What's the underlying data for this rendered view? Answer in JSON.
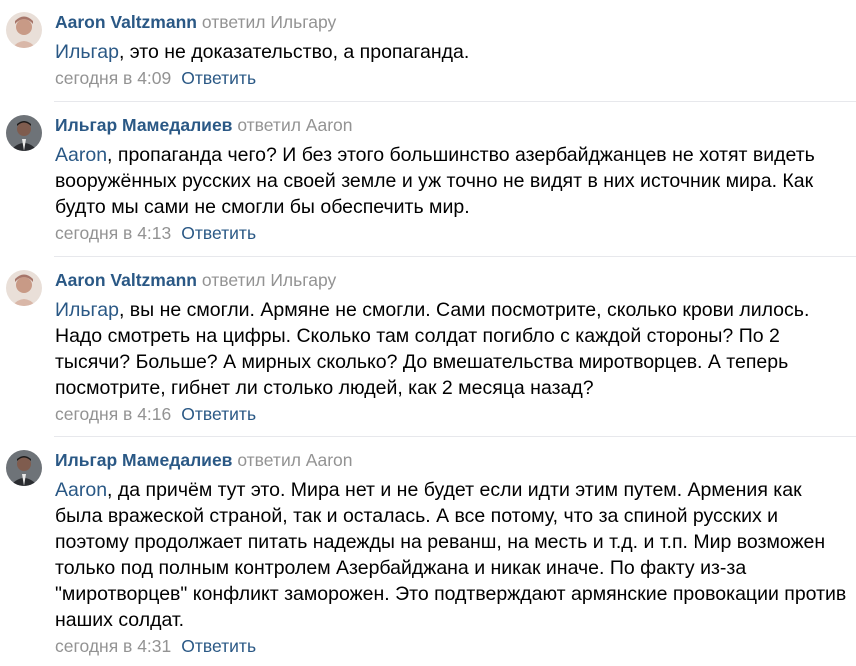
{
  "comments": [
    {
      "author": "Aaron Valtzmann",
      "replied_to": "ответил Ильгару",
      "mention": "Ильгар",
      "text": ", это не доказательство, а пропаганда.",
      "time": "сегодня в 4:09",
      "reply_label": "Ответить",
      "avatar_icon": "user-avatar-icon"
    },
    {
      "author": "Ильгар Мамедалиев",
      "replied_to": "ответил Aaron",
      "mention": "Aaron",
      "text": ", пропаганда чего? И без этого большинство азербайджанцев не хотят видеть вооружённых русских на своей земле и уж точно не видят в них источник мира. Как будто мы сами не смогли бы обеспечить мир.",
      "time": "сегодня в 4:13",
      "reply_label": "Ответить",
      "avatar_icon": "user-avatar-icon"
    },
    {
      "author": "Aaron Valtzmann",
      "replied_to": "ответил Ильгару",
      "mention": "Ильгар",
      "text": ", вы не смогли. Армяне не смогли. Сами посмотрите, сколько крови лилось. Надо смотреть на цифры. Сколько там солдат погибло с каждой стороны? По 2 тысячи? Больше? А мирных сколько? До вмешательства миротворцев. А теперь посмотрите, гибнет ли столько людей, как 2 месяца назад?",
      "time": "сегодня в 4:16",
      "reply_label": "Ответить",
      "avatar_icon": "user-avatar-icon"
    },
    {
      "author": "Ильгар Мамедалиев",
      "replied_to": "ответил Aaron",
      "mention": "Aaron",
      "text": ", да причём тут это. Мира нет и не будет если идти этим путем. Армения как была вражеской страной, так и осталась. А все потому, что за спиной русских и поэтому продолжает питать надежды на реванш, на месть и т.д. и т.п. Мир возможен только под полным контролем Азербайджана и никак иначе. По факту из-за \"миротворцев\" конфликт заморожен. Это подтверждают армянские провокации против наших солдат.",
      "time": "сегодня в 4:31",
      "reply_label": "Ответить",
      "avatar_icon": "user-avatar-icon"
    }
  ],
  "colors": {
    "link": "#2a5885",
    "muted": "#939393",
    "divider": "#e7e8ec"
  }
}
